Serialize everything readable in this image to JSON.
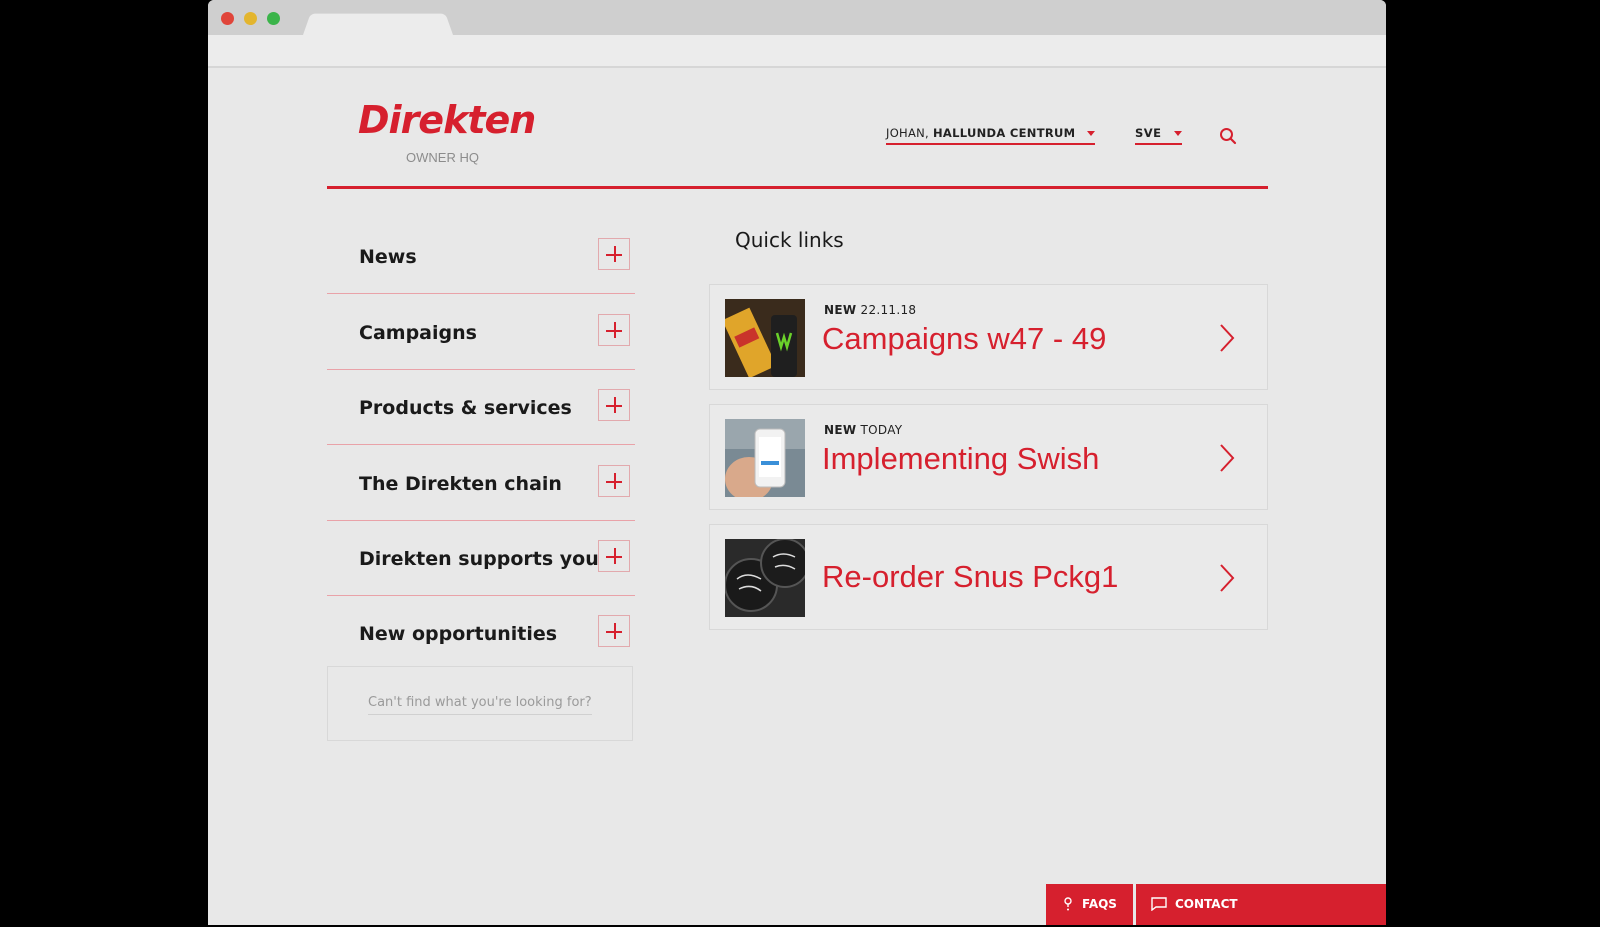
{
  "brand": {
    "logo": "Direkten",
    "subtitle": "OWNER HQ"
  },
  "header": {
    "user_prefix": "JOHAN,",
    "user_store": "HALLUNDA CENTRUM",
    "language": "SVE",
    "search_icon": "search-icon"
  },
  "sidebar": {
    "items": [
      {
        "label": "News"
      },
      {
        "label": "Campaigns"
      },
      {
        "label": "Products & services"
      },
      {
        "label": "The Direkten chain"
      },
      {
        "label": "Direkten supports you"
      },
      {
        "label": "New opportunities"
      }
    ],
    "cant_find": "Can't find what you're looking for?"
  },
  "quick_links": {
    "title": "Quick links",
    "items": [
      {
        "badge": "NEW",
        "date": "22.11.18",
        "title": "Campaigns w47 - 49"
      },
      {
        "badge": "NEW",
        "date": "TODAY",
        "title": "Implementing Swish"
      },
      {
        "badge": "",
        "date": "",
        "title": "Re-order Snus Pckg1"
      }
    ]
  },
  "footer": {
    "faqs": "FAQS",
    "contact": "CONTACT"
  },
  "colors": {
    "accent": "#d6202e",
    "background": "#e8e8e8"
  }
}
